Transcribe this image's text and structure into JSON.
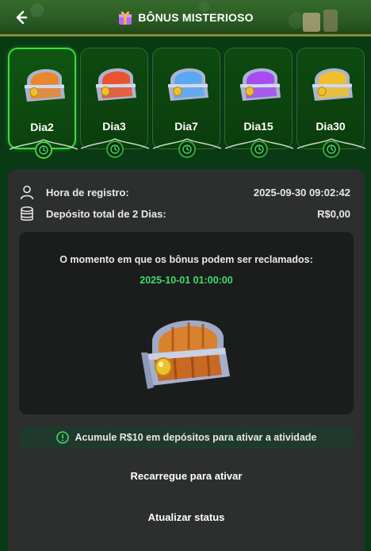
{
  "header": {
    "title": "BÔNUS MISTERIOSO"
  },
  "days": [
    {
      "label": "Dia2",
      "chest_color": "#e8872c",
      "active": true
    },
    {
      "label": "Dia3",
      "chest_color": "#e8542c",
      "active": false
    },
    {
      "label": "Dia7",
      "chest_color": "#5aa8f0",
      "active": false
    },
    {
      "label": "Dia15",
      "chest_color": "#a64cf0",
      "active": false
    },
    {
      "label": "Dia30",
      "chest_color": "#f0c02c",
      "active": false
    }
  ],
  "info": {
    "registration_label": "Hora de registro:",
    "registration_value": "2025-09-30 09:02:42",
    "deposit_label": "Depósito total de 2 Dias:",
    "deposit_value": "R$0,00"
  },
  "claim": {
    "message": "O momento em que os bônus podem ser reclamados:",
    "date": "2025-10-01 01:00:00"
  },
  "alert": {
    "text": "Acumule R$10 em depósitos para ativar a atividade"
  },
  "buttons": {
    "recharge": "Recarregue para ativar",
    "refresh": "Atualizar status"
  },
  "colors": {
    "accent_green": "#3cdc3c",
    "date_green": "#3ddc6a",
    "panel_bg": "#2c2f2e",
    "page_bg": "#0a3a14"
  }
}
